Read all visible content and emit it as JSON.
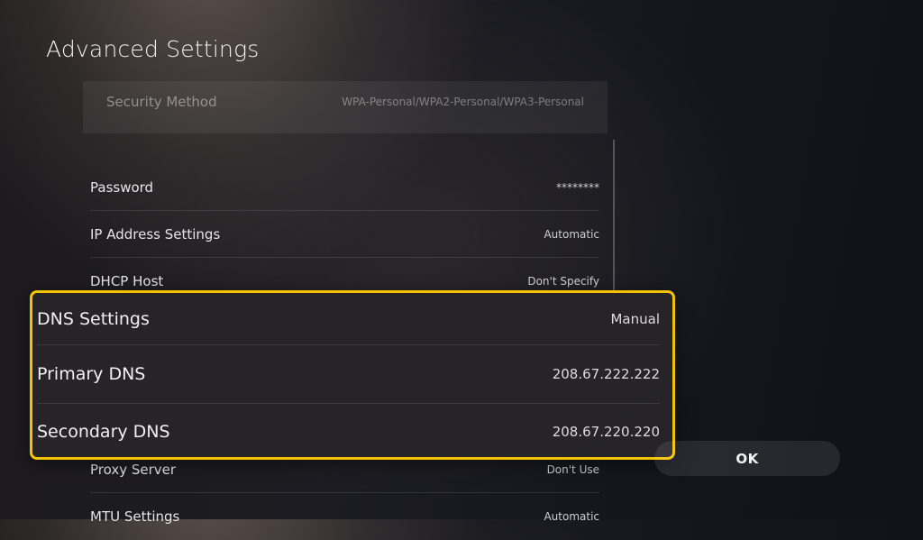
{
  "page": {
    "title": "Advanced Settings"
  },
  "settings": {
    "security_method": {
      "label": "Security Method",
      "value": "WPA-Personal/WPA2-Personal/WPA3-Personal"
    },
    "password": {
      "label": "Password",
      "value": "********"
    },
    "ip_address": {
      "label": "IP Address Settings",
      "value": "Automatic"
    },
    "dhcp_host": {
      "label": "DHCP Host",
      "value": "Don't Specify"
    },
    "dns_settings": {
      "label": "DNS Settings",
      "value": "Manual"
    },
    "primary_dns": {
      "label": "Primary DNS",
      "value": "208.67.222.222"
    },
    "secondary_dns": {
      "label": "Secondary DNS",
      "value": "208.67.220.220"
    },
    "proxy_server": {
      "label": "Proxy Server",
      "value": "Don't Use"
    },
    "mtu": {
      "label": "MTU Settings",
      "value": "Automatic"
    }
  },
  "actions": {
    "ok_label": "OK"
  },
  "colors": {
    "focus": "#f3c200",
    "background": "#15161d"
  }
}
